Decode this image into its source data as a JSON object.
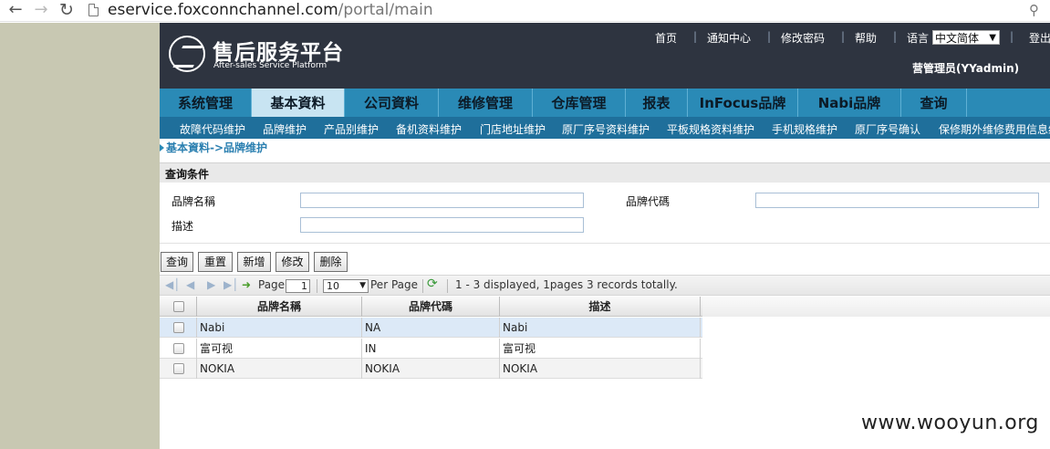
{
  "browser": {
    "url_host": "eservice.foxconnchannel.com",
    "url_path": "/portal/main"
  },
  "header": {
    "title": "售后服务平台",
    "subtitle": "After-sales Service Platform",
    "links": [
      "首页",
      "通知中心",
      "修改密码",
      "帮助"
    ],
    "language_label": "语言",
    "language_value": "中文简体",
    "logout": "登出",
    "user": "营管理员(YYadmin)"
  },
  "mainmenu": [
    {
      "label": "系统管理",
      "active": false
    },
    {
      "label": "基本資料",
      "active": true
    },
    {
      "label": "公司資料",
      "active": false
    },
    {
      "label": "维修管理",
      "active": false
    },
    {
      "label": "仓库管理",
      "active": false
    },
    {
      "label": "报表",
      "active": false
    },
    {
      "label": "InFocus品牌",
      "active": false
    },
    {
      "label": "Nabi品牌",
      "active": false
    },
    {
      "label": "查询",
      "active": false
    }
  ],
  "submenu": [
    "故障代码维护",
    "品牌维护",
    "产品别维护",
    "备机资料维护",
    "门店地址维护",
    "原厂序号资料维护",
    "平板规格资料维护",
    "手机规格维护",
    "原厂序号确认",
    "保修期外维修费用信息维护"
  ],
  "breadcrumb": "基本資料->品牌维护",
  "query": {
    "title": "查询条件",
    "brand_name_label": "品牌名稱",
    "brand_code_label": "品牌代碼",
    "desc_label": "描述",
    "brand_name_value": "",
    "brand_code_value": "",
    "desc_value": ""
  },
  "buttons": {
    "query": "查询",
    "reset": "重置",
    "add": "新增",
    "edit": "修改",
    "delete": "删除"
  },
  "pager": {
    "page_label": "Page",
    "page_value": "1",
    "page_size": "10",
    "per_page_label": "Per Page",
    "summary": "1 - 3 displayed, 1pages 3 records totally."
  },
  "grid": {
    "columns": [
      "品牌名稱",
      "品牌代碼",
      "描述"
    ],
    "rows": [
      {
        "name": "Nabi",
        "code": "NA",
        "desc": "Nabi"
      },
      {
        "name": "富可视",
        "code": "IN",
        "desc": "富可视"
      },
      {
        "name": "NOKIA",
        "code": "NOKIA",
        "desc": "NOKIA"
      }
    ]
  },
  "watermark": "www.wooyun.org",
  "colors": {
    "header_bg": "#2e3440",
    "menu_bg": "#2a8ab6",
    "submenu_bg": "#1f6f9b",
    "left_frame": "#c8c8b2"
  },
  "icons": [
    "back-arrow-icon",
    "forward-arrow-icon",
    "reload-icon",
    "page-icon",
    "extension-icon",
    "first-page-icon",
    "prev-page-icon",
    "next-page-icon",
    "last-page-icon",
    "go-icon",
    "refresh-icon",
    "logo-icon"
  ]
}
